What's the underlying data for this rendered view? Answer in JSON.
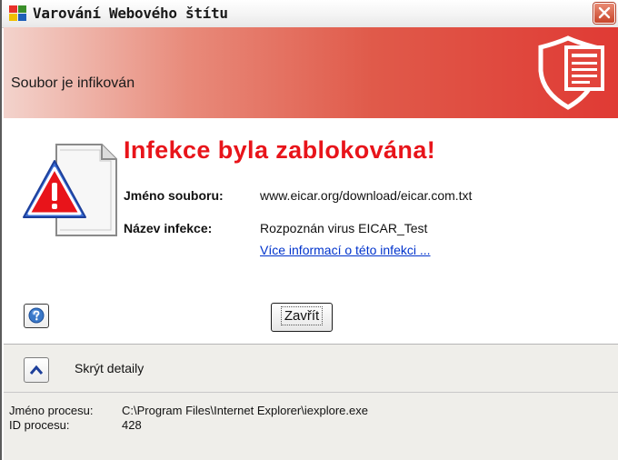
{
  "window": {
    "title": "Varování Webového štítu"
  },
  "header": {
    "title": "Soubor je infikován"
  },
  "alert": {
    "headline": "Infekce byla zablokována!",
    "fields": [
      {
        "label": "Jméno souboru:",
        "value": "www.eicar.org/download/eicar.com.txt"
      },
      {
        "label": "Název infekce:",
        "value": "Rozpoznán virus EICAR_Test"
      }
    ],
    "more_info_link": "Více informací o této infekci ..."
  },
  "buttons": {
    "close_label": "Zavřít"
  },
  "details": {
    "toggle_label": "Skrýt detaily",
    "rows": [
      {
        "label": "Jméno procesu:",
        "value": "C:\\Program Files\\Internet Explorer\\iexplore.exe"
      },
      {
        "label": "ID procesu:",
        "value": "428"
      }
    ]
  },
  "icons": {
    "app": "avg-logo-icon",
    "close": "close-icon",
    "shield": "shield-icon",
    "warning": "warning-document-icon",
    "help": "help-icon",
    "collapse": "chevron-up-icon"
  },
  "colors": {
    "headline": "#e8141a",
    "link": "#0033cc",
    "header_gradient_end": "#e03a34",
    "details_bg": "#efeeea"
  }
}
